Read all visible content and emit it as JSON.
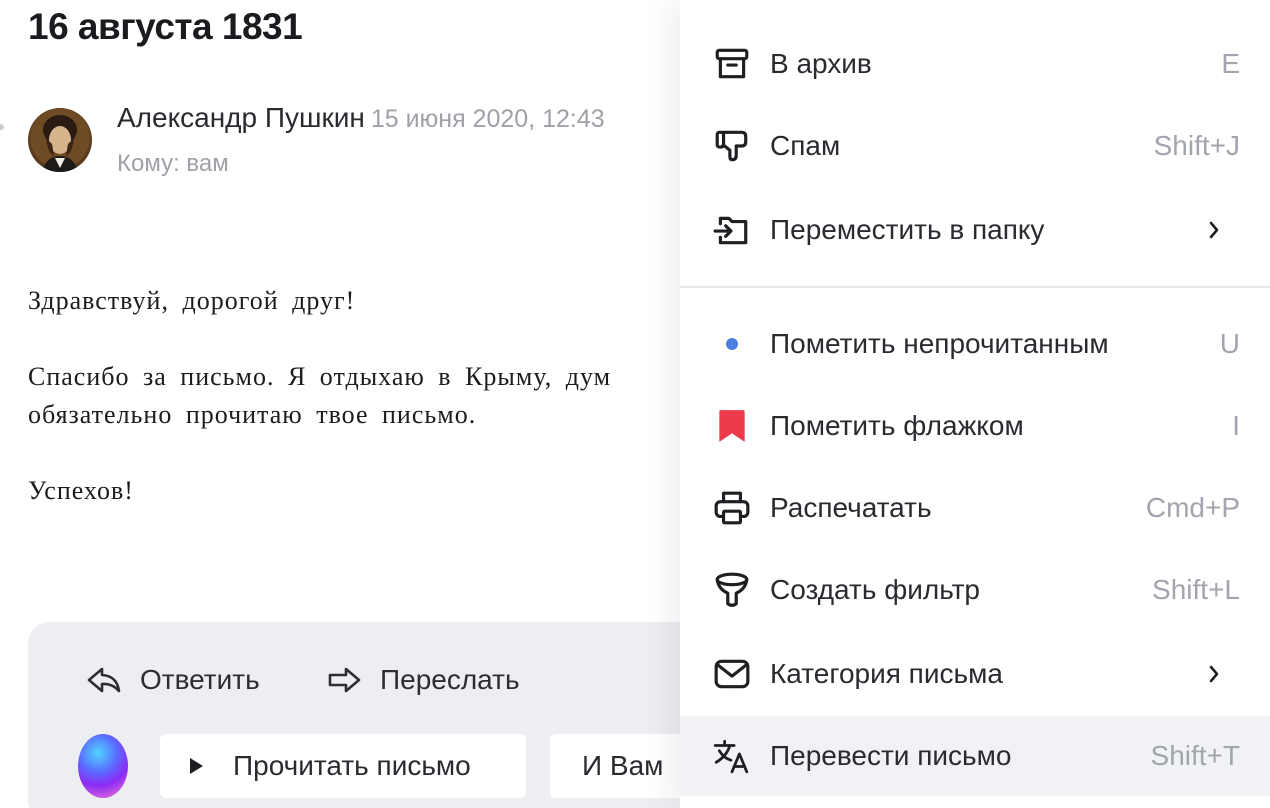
{
  "letter": {
    "subject": "16 августа 1831",
    "sender_name": "Александр Пушкин",
    "date": "15 июня 2020, 12:43",
    "recipient": "Кому: вам",
    "paragraphs": [
      "Здравствуй, дорогой друг!",
      "Спасибо за письмо. Я отдыхаю в Крыму, дум",
      "обязательно прочитаю твое письмо.",
      "Успехов!"
    ]
  },
  "actions": {
    "reply_label": "Ответить",
    "forward_label": "Переслать",
    "read_label": "Прочитать письмо",
    "quick_reply_label": "И Вам"
  },
  "menu": {
    "items": [
      {
        "label": "В архив",
        "shortcut": "E",
        "icon": "archive-icon"
      },
      {
        "label": "Спам",
        "shortcut": "Shift+J",
        "icon": "thumbs-down-icon"
      },
      {
        "label": "Переместить в папку",
        "shortcut": "",
        "icon": "move-to-folder-icon",
        "submenu": true
      },
      {
        "label": "Пометить непрочитанным",
        "shortcut": "U",
        "icon": "unread-dot-icon"
      },
      {
        "label": "Пометить флажком",
        "shortcut": "I",
        "icon": "flag-icon"
      },
      {
        "label": "Распечатать",
        "shortcut": "Cmd+P",
        "icon": "printer-icon"
      },
      {
        "label": "Создать фильтр",
        "shortcut": "Shift+L",
        "icon": "filter-icon"
      },
      {
        "label": "Категория письма",
        "shortcut": "",
        "icon": "envelope-icon",
        "submenu": true
      },
      {
        "label": "Перевести письмо",
        "shortcut": "Shift+T",
        "icon": "translate-icon",
        "highlighted": true
      }
    ]
  },
  "colors": {
    "accent_blue": "#4a7fe0",
    "flag_red": "#ee3b4b",
    "muted_text": "#9ea1a8",
    "toolbar_bg": "#eceef2",
    "highlight_bg": "#f1f2f5"
  }
}
